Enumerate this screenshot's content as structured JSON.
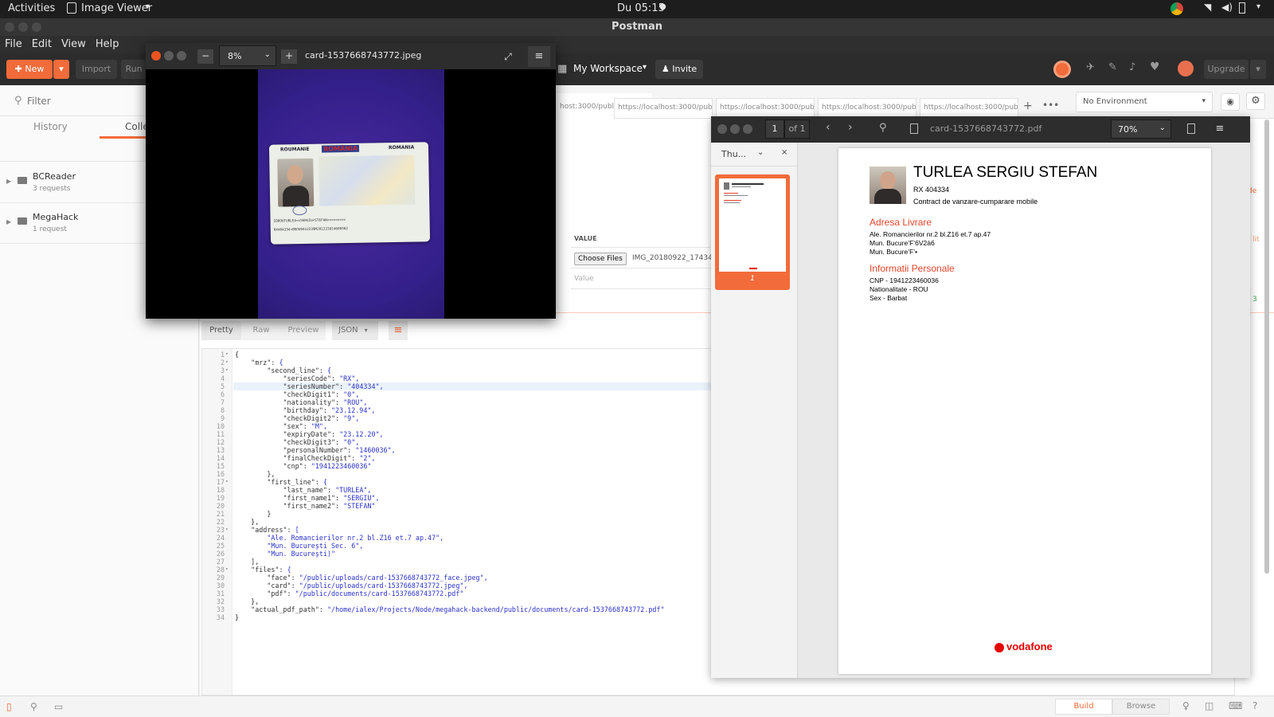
{
  "gnome": {
    "activities": "Activities",
    "app_menu": "Image Viewer",
    "clock": "Du 05:15"
  },
  "window_title": "Postman",
  "menu": [
    "File",
    "Edit",
    "View",
    "Help"
  ],
  "header": {
    "new_label": "New",
    "import_label": "Import",
    "runner_label": "Run",
    "workspace": "My Workspace",
    "invite": "Invite",
    "upgrade": "Upgrade"
  },
  "sidebar": {
    "filter_placeholder": "Filter",
    "tab_history": "History",
    "tab_collections": "Colle",
    "collections": [
      {
        "name": "BCReader",
        "count": "3 requests"
      },
      {
        "name": "MegaHack",
        "count": "1 request"
      }
    ]
  },
  "request_tabs": [
    "host:3000/publi",
    "https://localhost:3000/publi",
    "https://localhost:3000/publi",
    "https://localhost:3000/publi",
    "https://localhost:3000/publi"
  ],
  "environment": "No Environment",
  "body_form": {
    "value_header": "VALUE",
    "choose_files": "Choose Files",
    "file_name": "IMG_20180922_17434",
    "value_placeholder": "Value"
  },
  "response": {
    "tab_pretty": "Pretty",
    "tab_raw": "Raw",
    "tab_preview": "Preview",
    "format": "JSON",
    "lines": [
      "{",
      "    \"mrz\": {",
      "        \"second_line\": {",
      "            \"seriesCode\": \"RX\",",
      "            \"seriesNumber\": \"404334\",",
      "            \"checkDigit1\": \"0\",",
      "            \"nationality\": \"ROU\",",
      "            \"birthday\": \"23.12.94\",",
      "            \"checkDigit2\": \"9\",",
      "            \"sex\": \"M\",",
      "            \"expiryDate\": \"23.12.20\",",
      "            \"checkDigit3\": \"0\",",
      "            \"personalNumber\": \"1460036\",",
      "            \"finalCheckDigit\": \"2\",",
      "            \"cnp\": \"1941223460036\"",
      "        },",
      "        \"first_line\": {",
      "            \"last_name\": \"TURLEA\",",
      "            \"first_name1\": \"SERGIU\",",
      "            \"first_name2\": \"STEFAN\"",
      "        }",
      "    },",
      "    \"address\": [",
      "        \"Ale. Romancierilor nr.2 bl.Z16 et.7 ap.47\",",
      "        \"Mun. București Sec. 6\",",
      "        \"Mun. București)\"",
      "    ],",
      "    \"files\": {",
      "        \"face\": \"/public/uploads/card-1537668743772_face.jpeg\",",
      "        \"card\": \"/public/uploads/card-1537668743772.jpeg\",",
      "        \"pdf\": \"/public/documents/card-1537668743772.pdf\"",
      "    },",
      "    \"actual_pdf_path\": \"/home/ialex/Projects/Node/megahack-backend/public/documents/card-1537668743772.pdf\"",
      "}"
    ]
  },
  "image_viewer": {
    "zoom": "8%",
    "filename": "card-1537668743772.jpeg",
    "card": {
      "country_left": "ROUMANIE",
      "country_brand": "ROMÂNIA",
      "country_right": "ROMANIA",
      "mrz1": "IDROUTURLEA<<SERGIU<STEFAN<<<<<<<<<",
      "mrz2": "RX404334<0ROU9412239M201223814600362"
    }
  },
  "pdf_viewer": {
    "page": "1",
    "of": "of 1",
    "filename": "card-1537668743772.pdf",
    "zoom": "70%",
    "sidebar_label": "Thu...",
    "thumb_page": "1",
    "doc": {
      "name": "TURLEA SERGIU STEFAN",
      "id": "RX 404334",
      "subtitle": "Contract de vanzare-cumparare mobile",
      "section1": "Adresa Livrare",
      "addr1": "Ale. Romancierilor nr.2 bl.Z16 et.7 ap.47",
      "addr2": "Mun. Bucure’F’6V2à6",
      "addr3": "Mun. Bucure’F’•",
      "section2": "Informatii Personale",
      "cnp": "CNP - 1941223460036",
      "nat": "Nationalitate - ROU",
      "sex": "Sex - Barbat",
      "brand": "vodafone"
    }
  },
  "statusbar": {
    "build": "Build",
    "browse": "Browse"
  },
  "colors": {
    "accent": "#f26b3a",
    "pdf_heading": "#e8452c",
    "vodafone": "#e60000"
  }
}
